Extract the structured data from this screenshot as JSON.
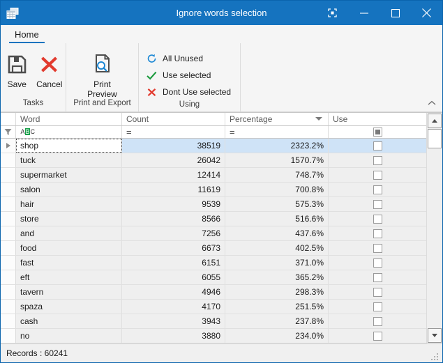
{
  "window": {
    "title": "Ignore words selection",
    "app_icon": "grid-windows-icon",
    "controls": {
      "restore_layout": "fit-screen-icon",
      "minimize": "minimize-icon",
      "maximize": "maximize-icon",
      "close": "close-icon"
    }
  },
  "ribbon": {
    "tabs": [
      {
        "label": "Home",
        "active": true
      }
    ],
    "collapse_icon": "chevron-up-icon",
    "groups": [
      {
        "label": "Tasks",
        "buttons": [
          {
            "label": "Save",
            "icon": "save-floppy-icon"
          },
          {
            "label": "Cancel",
            "icon": "red-x-icon"
          }
        ]
      },
      {
        "label": "Print and Export",
        "buttons": [
          {
            "label": "Print\nPreview",
            "label_line1": "Print",
            "label_line2": "Preview",
            "icon": "print-preview-icon"
          }
        ]
      },
      {
        "label": "Using",
        "items": [
          {
            "label": "All Unused",
            "icon": "refresh-circular-arrow-icon"
          },
          {
            "label": "Use selected",
            "icon": "green-check-icon"
          },
          {
            "label": "Dont Use selected",
            "icon": "red-x-icon"
          }
        ]
      }
    ]
  },
  "grid": {
    "columns": [
      {
        "key": "word",
        "label": "Word",
        "sort": "none"
      },
      {
        "key": "count",
        "label": "Count",
        "sort": "none"
      },
      {
        "key": "percentage",
        "label": "Percentage",
        "sort": "desc"
      },
      {
        "key": "use",
        "label": "Use",
        "sort": "none"
      }
    ],
    "filter_row": {
      "filter_icon": "funnel-icon",
      "word": {
        "type": "abc-icon",
        "a": "A",
        "b": "B",
        "c": "C"
      },
      "count": "=",
      "percentage": "=",
      "use": "indeterminate-checkbox"
    },
    "selected_row_index": 0,
    "rows": [
      {
        "word": "shop",
        "count": "38519",
        "percentage": "2323.2%",
        "use": false
      },
      {
        "word": "tuck",
        "count": "26042",
        "percentage": "1570.7%",
        "use": false
      },
      {
        "word": "supermarket",
        "count": "12414",
        "percentage": "748.7%",
        "use": false
      },
      {
        "word": "salon",
        "count": "11619",
        "percentage": "700.8%",
        "use": false
      },
      {
        "word": "hair",
        "count": "9539",
        "percentage": "575.3%",
        "use": false
      },
      {
        "word": "store",
        "count": "8566",
        "percentage": "516.6%",
        "use": false
      },
      {
        "word": "and",
        "count": "7256",
        "percentage": "437.6%",
        "use": false
      },
      {
        "word": "food",
        "count": "6673",
        "percentage": "402.5%",
        "use": false
      },
      {
        "word": "fast",
        "count": "6151",
        "percentage": "371.0%",
        "use": false
      },
      {
        "word": "eft",
        "count": "6055",
        "percentage": "365.2%",
        "use": false
      },
      {
        "word": "tavern",
        "count": "4946",
        "percentage": "298.3%",
        "use": false
      },
      {
        "word": "spaza",
        "count": "4170",
        "percentage": "251.5%",
        "use": false
      },
      {
        "word": "cash",
        "count": "3943",
        "percentage": "237.8%",
        "use": false
      },
      {
        "word": "no",
        "count": "3880",
        "percentage": "234.0%",
        "use": false
      }
    ],
    "scrollbar": {
      "up_icon": "scroll-up-arrow",
      "down_icon": "scroll-down-arrow"
    }
  },
  "statusbar": {
    "records_label": "Records : 60241"
  },
  "colors": {
    "titlebar": "#1573bf",
    "accent": "#1573bf",
    "selection": "#cfe3f7",
    "row_bg": "#efefef",
    "green": "#18a04a",
    "red": "#e23a2e"
  }
}
